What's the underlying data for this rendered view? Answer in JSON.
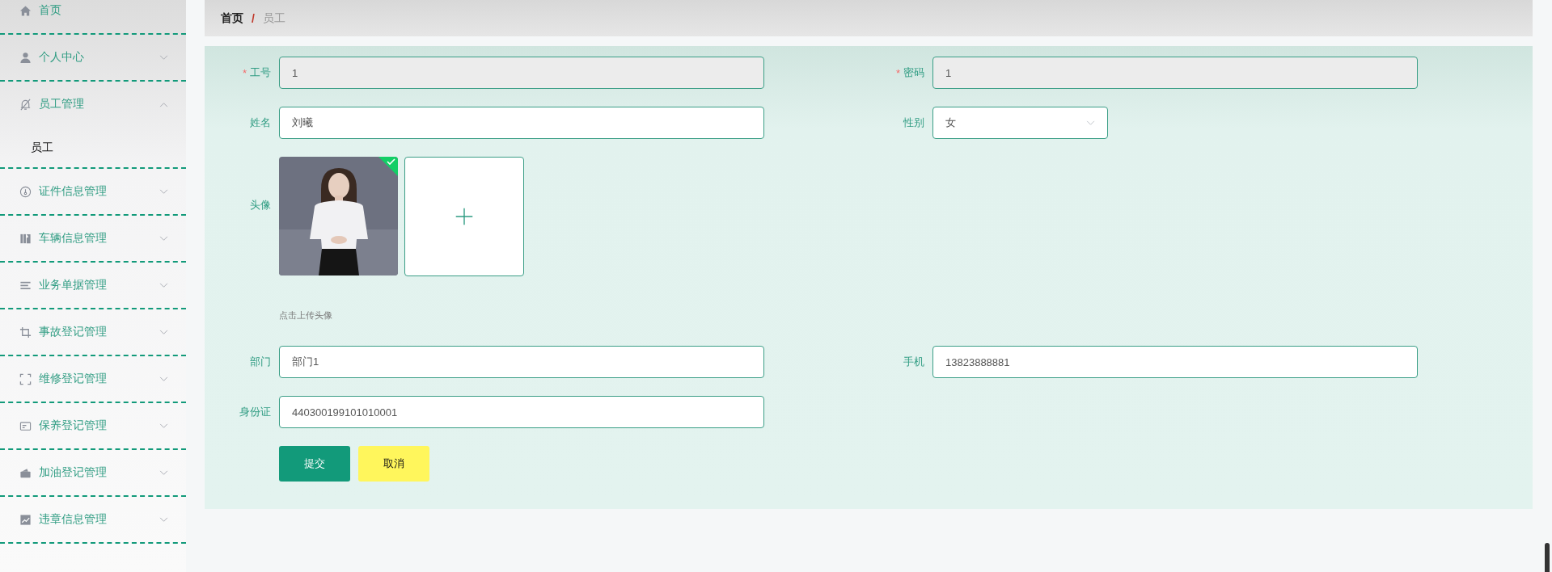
{
  "sidebar": {
    "items": [
      {
        "label": "首页",
        "kind": "link"
      },
      {
        "label": "个人中心",
        "kind": "submenu",
        "expanded": false
      },
      {
        "label": "员工管理",
        "kind": "submenu",
        "expanded": true,
        "children": [
          {
            "label": "员工",
            "selected": true
          }
        ]
      },
      {
        "label": "证件信息管理",
        "kind": "submenu",
        "expanded": false
      },
      {
        "label": "车辆信息管理",
        "kind": "submenu",
        "expanded": false
      },
      {
        "label": "业务单据管理",
        "kind": "submenu",
        "expanded": false
      },
      {
        "label": "事故登记管理",
        "kind": "submenu",
        "expanded": false
      },
      {
        "label": "维修登记管理",
        "kind": "submenu",
        "expanded": false
      },
      {
        "label": "保养登记管理",
        "kind": "submenu",
        "expanded": false
      },
      {
        "label": "加油登记管理",
        "kind": "submenu",
        "expanded": false
      },
      {
        "label": "违章信息管理",
        "kind": "submenu",
        "expanded": false
      }
    ]
  },
  "breadcrumb": {
    "items": [
      "首页",
      "员工"
    ],
    "separator": "/"
  },
  "form": {
    "rows": [
      [
        {
          "label": "工号",
          "kind": "text",
          "required_mark": "*",
          "disabled": true,
          "value": "1"
        },
        {
          "label": "密码",
          "kind": "text",
          "required_mark": "*",
          "disabled": true,
          "value": "1"
        }
      ],
      [
        {
          "label": "姓名",
          "kind": "text",
          "disabled": false,
          "value": "刘曦"
        },
        {
          "label": "性别",
          "kind": "select",
          "value": "女"
        }
      ],
      [
        {
          "label": "头像",
          "kind": "upload",
          "uploaded": true,
          "hint": "点击上传头像"
        }
      ],
      [
        {
          "label": "部门",
          "kind": "text",
          "disabled": false,
          "value": "部门1"
        },
        {
          "label": "手机",
          "kind": "text",
          "disabled": false,
          "value": "13823888881"
        }
      ],
      [
        {
          "label": "身份证",
          "kind": "text",
          "disabled": false,
          "value": "440300199101010001"
        }
      ]
    ],
    "buttons": [
      {
        "label": "提交",
        "kind": "primary"
      },
      {
        "label": "取消",
        "kind": "cancel"
      }
    ]
  }
}
